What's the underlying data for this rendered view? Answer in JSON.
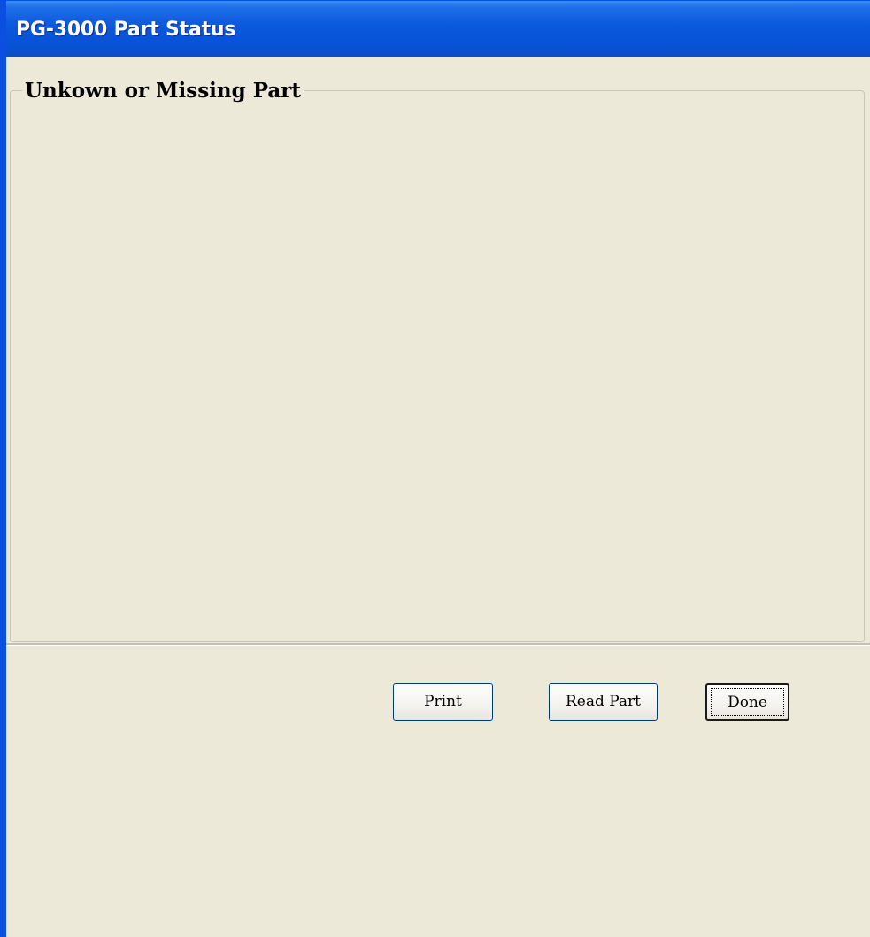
{
  "window": {
    "title": "PG-3000 Part Status"
  },
  "group": {
    "legend": "Unkown or Missing Part"
  },
  "buttons": {
    "print": "Print",
    "read_part": "Read Part",
    "done": "Done"
  },
  "colors": {
    "titlebar": "#0a58dc",
    "window_face": "#ece9d8",
    "title_text": "#ffffff"
  }
}
